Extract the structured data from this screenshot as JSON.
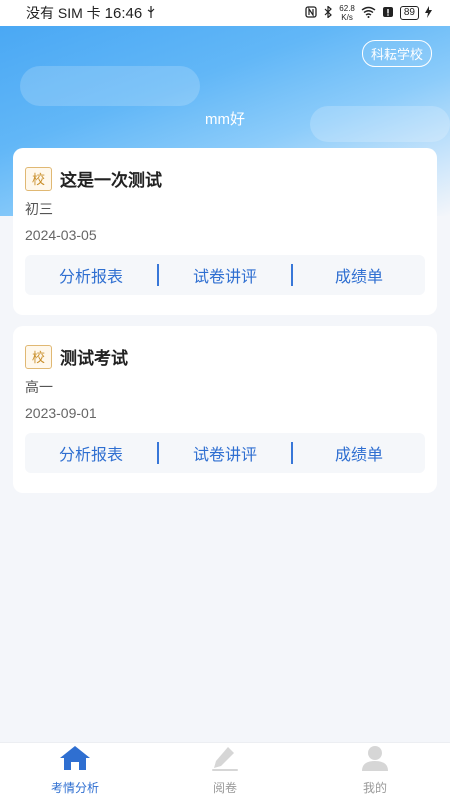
{
  "status_bar": {
    "carrier": "没有 SIM 卡",
    "time": "16:46",
    "net_speed_value": "62.8",
    "net_speed_unit": "K/s",
    "battery": "89"
  },
  "header": {
    "school_button": "科耘学校",
    "greeting": "mm好"
  },
  "exams": [
    {
      "tag": "校",
      "title": "这是一次测试",
      "grade": "初三",
      "date": "2024-03-05",
      "actions": [
        "分析报表",
        "试卷讲评",
        "成绩单"
      ]
    },
    {
      "tag": "校",
      "title": "测试考试",
      "grade": "高一",
      "date": "2023-09-01",
      "actions": [
        "分析报表",
        "试卷讲评",
        "成绩单"
      ]
    }
  ],
  "tabbar": {
    "active_color": "#2f6fd1",
    "items": [
      {
        "label": "考情分析",
        "icon": "home-icon"
      },
      {
        "label": "阅卷",
        "icon": "pen-icon"
      },
      {
        "label": "我的",
        "icon": "user-icon"
      }
    ]
  }
}
